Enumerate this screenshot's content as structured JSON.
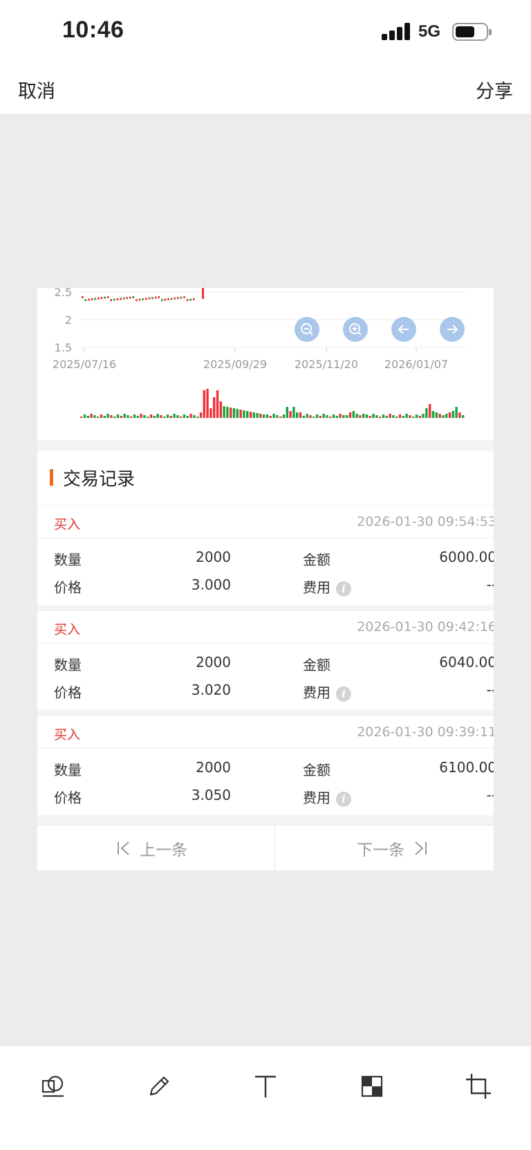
{
  "status_bar": {
    "time": "10:46",
    "network": "5G"
  },
  "topbar": {
    "cancel_label": "取消",
    "share_label": "分享"
  },
  "chart_data": {
    "type": "candlestick",
    "y_ticks": [
      "2.5",
      "2",
      "1.5"
    ],
    "x_ticks": [
      "2025/07/16",
      "2025/09/29",
      "2025/11/20",
      "2026/01/07"
    ],
    "colors": {
      "up": "#f0313a",
      "down": "#1aa33a",
      "grid": "#ececec",
      "axis_text": "#999999"
    }
  },
  "chart_controls": [
    "zoom-out-icon",
    "zoom-in-icon",
    "arrow-left-icon",
    "arrow-right-icon"
  ],
  "section": {
    "title": "交易记录"
  },
  "labels": {
    "quantity": "数量",
    "price": "价格",
    "amount": "金额",
    "fee": "费用",
    "info": "i"
  },
  "records": [
    {
      "side": "买入",
      "time": "2026-01-30 09:54:53",
      "quantity": "2000",
      "price": "3.000",
      "amount": "6000.00",
      "fee": "--"
    },
    {
      "side": "买入",
      "time": "2026-01-30 09:42:16",
      "quantity": "2000",
      "price": "3.020",
      "amount": "6040.00",
      "fee": "--"
    },
    {
      "side": "买入",
      "time": "2026-01-30 09:39:11",
      "quantity": "2000",
      "price": "3.050",
      "amount": "6100.00",
      "fee": "--"
    }
  ],
  "pager": {
    "prev_label": "上一条",
    "next_label": "下一条"
  },
  "toolbar": [
    "shapes-icon",
    "pencil-icon",
    "text-icon",
    "mosaic-icon",
    "crop-icon"
  ],
  "accent": {
    "buy": "#e3322e",
    "section_bar": "#ef6a1f",
    "chart_button": "#a9c7ea"
  }
}
